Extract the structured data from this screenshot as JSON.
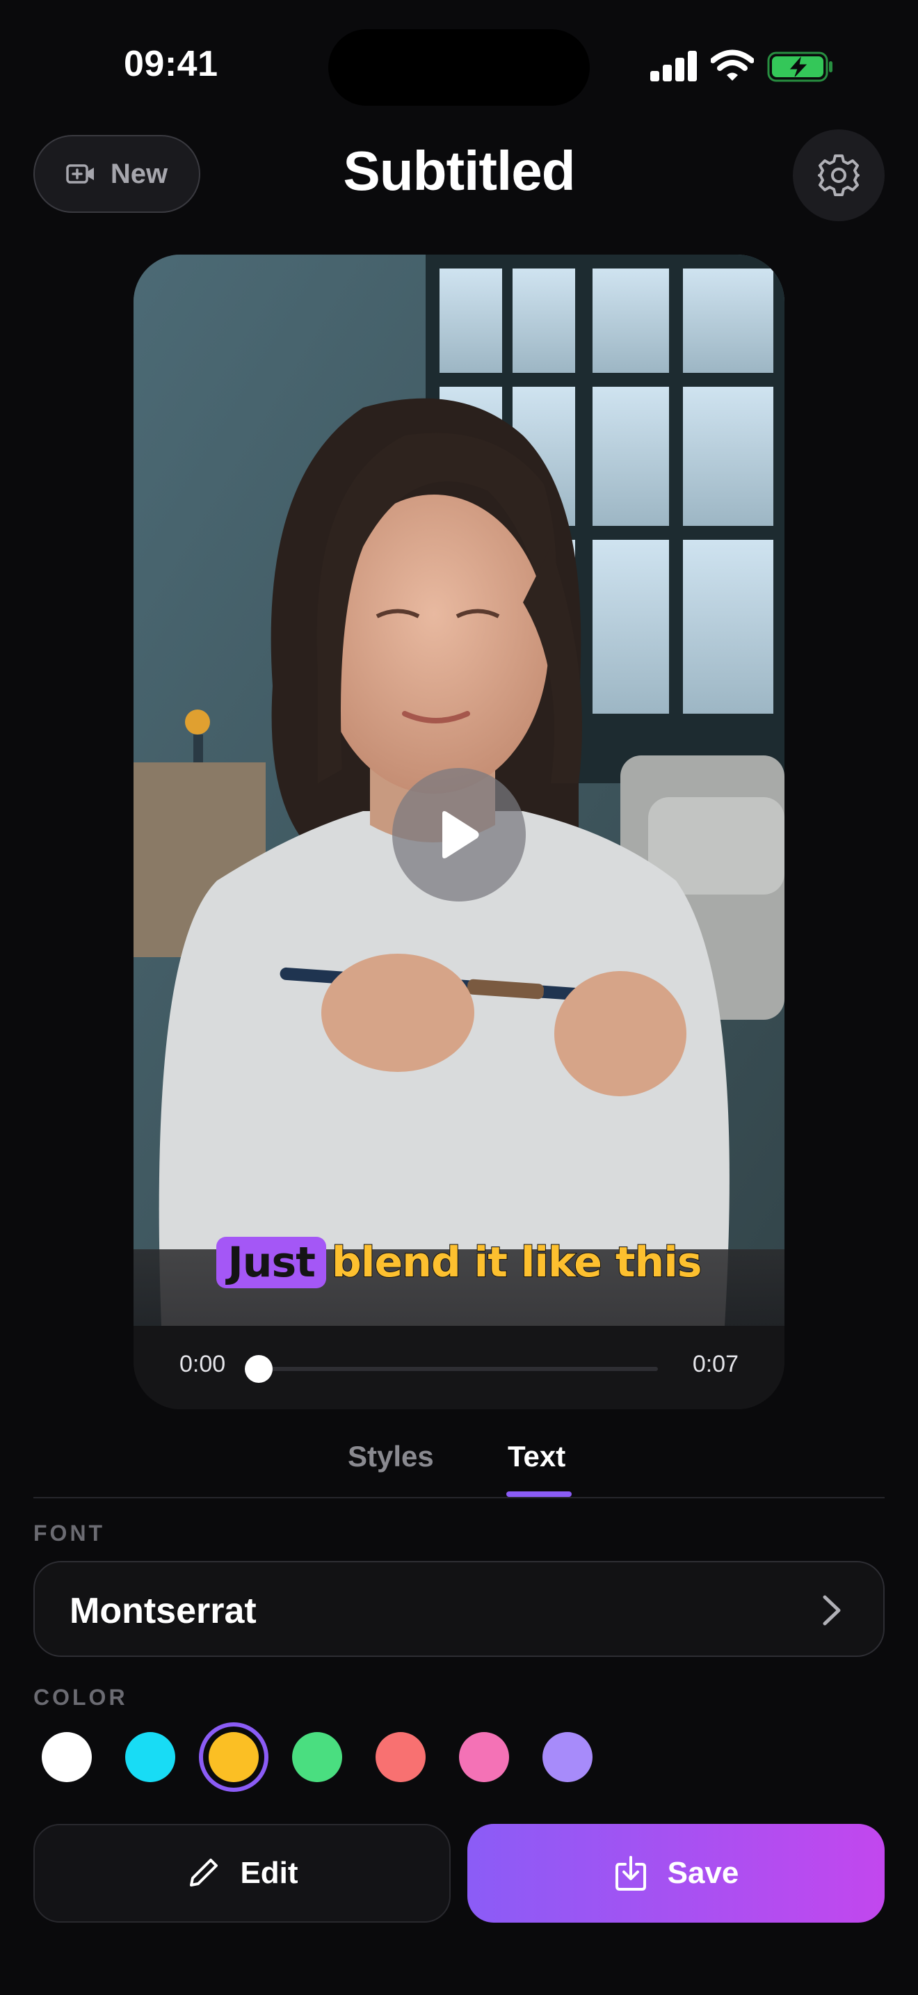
{
  "status_bar": {
    "time": "09:41"
  },
  "header": {
    "new_label": "New",
    "title": "Subtitled",
    "icons": {
      "new": "video-camera-icon",
      "settings": "gear-icon"
    }
  },
  "player": {
    "caption_highlight": "Just",
    "caption_rest": "blend it like this",
    "time_current": "0:00",
    "time_total": "0:07",
    "progress": 0.0,
    "play_icon": "play-icon"
  },
  "tabs": [
    {
      "label": "Styles",
      "selected": false
    },
    {
      "label": "Text",
      "selected": true
    }
  ],
  "font_section": {
    "label": "FONT",
    "value": "Montserrat"
  },
  "color_section": {
    "label": "COLOR",
    "swatches": [
      "#ffffff",
      "#18dcf5",
      "#fbbf24",
      "#4ade80",
      "#f87171",
      "#f472b6",
      "#a78bfa"
    ],
    "selected_index": 2
  },
  "actions": {
    "edit_label": "Edit",
    "save_label": "Save"
  },
  "colors": {
    "accent": "#8b5cf6",
    "caption_text": "#fdc02f",
    "caption_highlight": "#a457f6",
    "save_gradient_end": "#c247ee"
  }
}
